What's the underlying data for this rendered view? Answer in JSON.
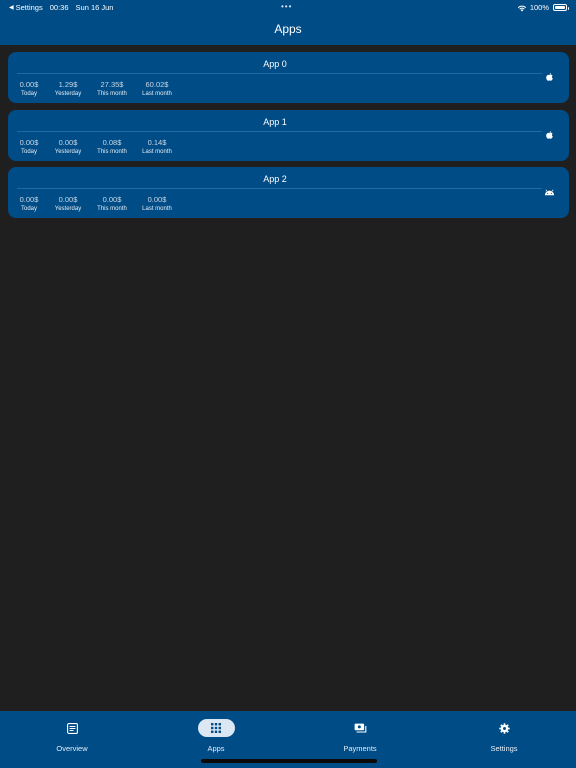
{
  "status_bar": {
    "back_label": "Settings",
    "time": "00:36",
    "date": "Sun 16 Jun",
    "dots": "•••",
    "battery_percent": "100%",
    "battery_level": 1.0
  },
  "header": {
    "title": "Apps"
  },
  "apps": [
    {
      "name": "App 0",
      "platform_icon": "apple-icon",
      "stats": [
        {
          "value": "0.00$",
          "label": "Today"
        },
        {
          "value": "1.29$",
          "label": "Yesterday"
        },
        {
          "value": "27.35$",
          "label": "This month"
        },
        {
          "value": "60.02$",
          "label": "Last month"
        }
      ]
    },
    {
      "name": "App 1",
      "platform_icon": "apple-icon",
      "stats": [
        {
          "value": "0.00$",
          "label": "Today"
        },
        {
          "value": "0.00$",
          "label": "Yesterday"
        },
        {
          "value": "0.08$",
          "label": "This month"
        },
        {
          "value": "0.14$",
          "label": "Last month"
        }
      ]
    },
    {
      "name": "App 2",
      "platform_icon": "android-icon",
      "stats": [
        {
          "value": "0.00$",
          "label": "Today"
        },
        {
          "value": "0.00$",
          "label": "Yesterday"
        },
        {
          "value": "0.00$",
          "label": "This month"
        },
        {
          "value": "0.00$",
          "label": "Last month"
        }
      ]
    }
  ],
  "tabbar": {
    "active": "Apps",
    "tabs": [
      {
        "label": "Overview",
        "icon": "list-icon"
      },
      {
        "label": "Apps",
        "icon": "grid-icon"
      },
      {
        "label": "Payments",
        "icon": "payments-icon"
      },
      {
        "label": "Settings",
        "icon": "gear-icon"
      }
    ]
  },
  "colors": {
    "header_bg": "#004c86",
    "card_bg": "#004c86",
    "page_bg": "#1f1f20",
    "active_tab_pill": "#dbe8f4"
  }
}
